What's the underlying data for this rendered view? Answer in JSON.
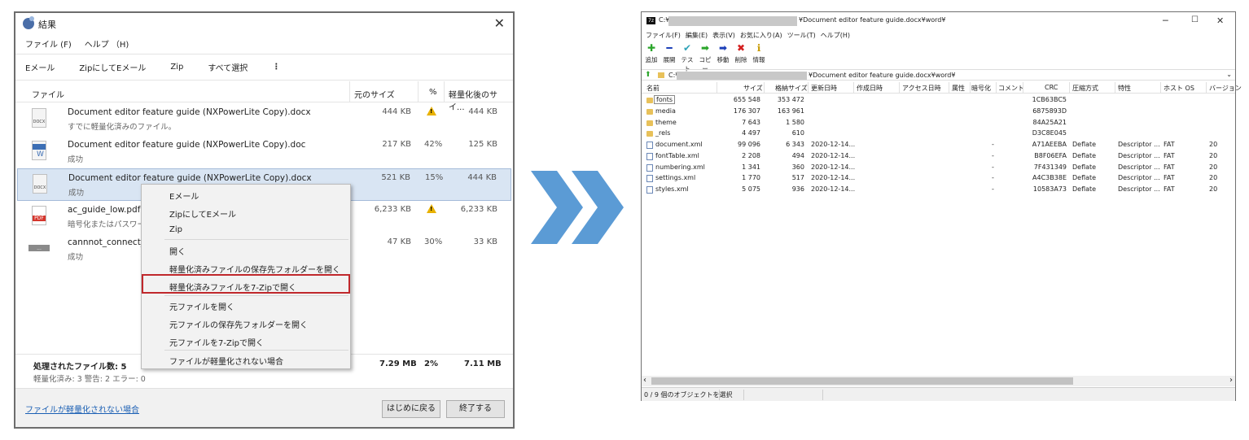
{
  "left_window": {
    "title": "結果",
    "close": "✕",
    "menu": [
      "ファイル (F)",
      "ヘルプ （H)"
    ],
    "toolbar": [
      "Eメール",
      "ZipにしてEメール",
      "Zip",
      "すべて選択",
      "⋮"
    ],
    "columns": {
      "file": "ファイル",
      "orig_size": "元のサイズ",
      "pct": "%",
      "new_size": "軽量化後のサイ..."
    },
    "rows": [
      {
        "name": "Document editor feature guide (NXPowerLite Copy).docx",
        "sub": "すでに軽量化済みのファイル。",
        "orig": "444 KB",
        "pct": "",
        "warn": true,
        "new": "444 KB",
        "icon_tag": "DOCX"
      },
      {
        "name": "Document editor feature guide (NXPowerLite Copy).doc",
        "sub": "成功",
        "orig": "217 KB",
        "pct": "42%",
        "warn": false,
        "new": "125 KB",
        "icon_tag": "DOC"
      },
      {
        "name": "Document editor feature guide (NXPowerLite Copy).docx",
        "sub": "成功",
        "orig": "521 KB",
        "pct": "15%",
        "warn": false,
        "new": "444 KB",
        "icon_tag": "DOCX"
      },
      {
        "name": "ac_guide_low.pdf",
        "sub": "暗号化またはパスワー",
        "orig": "6,233 KB",
        "pct": "",
        "warn": true,
        "new": "6,233 KB",
        "icon_tag": "PDF"
      },
      {
        "name": "cannnot_connect_tc",
        "sub": "成功",
        "orig": "47 KB",
        "pct": "30%",
        "warn": false,
        "new": "33 KB",
        "icon_tag": "..."
      }
    ],
    "totals": {
      "label": "処理されたファイル数: 5",
      "detail": "軽量化済み: 3  警告: 2  エラー: 0",
      "orig": "7.29 MB",
      "pct": "2%",
      "new": "7.11 MB"
    },
    "footer": {
      "link": "ファイルが軽量化されない場合",
      "back_button": "はじめに戻る",
      "finish_button": "終了する"
    }
  },
  "context_menu": {
    "items": [
      "Eメール",
      "ZipにしてEメール",
      "Zip",
      "開く",
      "軽量化済みファイルの保存先フォルダーを開く",
      "軽量化済みファイルを7-Zipで開く",
      "元ファイルを開く",
      "元ファイルの保存先フォルダーを開く",
      "元ファイルを7-Zipで開く",
      "ファイルが軽量化されない場合"
    ],
    "highlighted_index": 5,
    "highlight_color": "#c0282c"
  },
  "arrow_color": "#5b9bd5",
  "right_window": {
    "icon": "7z",
    "title_prefix": "C:¥",
    "title_suffix": "¥Document editor feature guide.docx¥word¥",
    "controls": [
      "─",
      "☐",
      "✕"
    ],
    "menu": [
      "ファイル(F)",
      "編集(E)",
      "表示(V)",
      "お気に入り(A)",
      "ツール(T)",
      "ヘルプ(H)"
    ],
    "toolbar": [
      {
        "label": "追加",
        "glyph": "✚",
        "color": "#2aa52a"
      },
      {
        "label": "展開",
        "glyph": "━",
        "color": "#1c3fb8"
      },
      {
        "label": "テスト",
        "glyph": "✔",
        "color": "#2fa3b8"
      },
      {
        "label": "コピー",
        "glyph": "➡",
        "color": "#2aa52a"
      },
      {
        "label": "移動",
        "glyph": "➡",
        "color": "#1c3fb8"
      },
      {
        "label": "削除",
        "glyph": "✖",
        "color": "#d42020"
      },
      {
        "label": "情報",
        "glyph": "ℹ",
        "color": "#c79a00"
      }
    ],
    "address_prefix": "C:¥",
    "address_suffix": "¥Document editor feature guide.docx¥word¥",
    "columns": [
      "名前",
      "サイズ",
      "格納サイズ",
      "更新日時",
      "作成日時",
      "アクセス日時",
      "属性",
      "暗号化",
      "コメント",
      "CRC",
      "圧縮方式",
      "特性",
      "ホスト OS",
      "バージョン"
    ],
    "rows": [
      {
        "type": "folder",
        "name": "fonts",
        "size": "655 548",
        "packed": "353 472",
        "modified": "",
        "enc": "",
        "crc": "1CB63BC5",
        "method": "",
        "char": "",
        "host": "",
        "ver": ""
      },
      {
        "type": "folder",
        "name": "media",
        "size": "176 307",
        "packed": "163 961",
        "modified": "",
        "enc": "",
        "crc": "6875893D",
        "method": "",
        "char": "",
        "host": "",
        "ver": ""
      },
      {
        "type": "folder",
        "name": "theme",
        "size": "7 643",
        "packed": "1 580",
        "modified": "",
        "enc": "",
        "crc": "84A25A21",
        "method": "",
        "char": "",
        "host": "",
        "ver": ""
      },
      {
        "type": "folder",
        "name": "_rels",
        "size": "4 497",
        "packed": "610",
        "modified": "",
        "enc": "",
        "crc": "D3C8E045",
        "method": "",
        "char": "",
        "host": "",
        "ver": ""
      },
      {
        "type": "file",
        "name": "document.xml",
        "size": "99 096",
        "packed": "6 343",
        "modified": "2020-12-14...",
        "enc": "-",
        "crc": "A71AEEBA",
        "method": "Deflate",
        "char": "Descriptor ...",
        "host": "FAT",
        "ver": "20"
      },
      {
        "type": "file",
        "name": "fontTable.xml",
        "size": "2 208",
        "packed": "494",
        "modified": "2020-12-14...",
        "enc": "-",
        "crc": "B8F06EFA",
        "method": "Deflate",
        "char": "Descriptor ...",
        "host": "FAT",
        "ver": "20"
      },
      {
        "type": "file",
        "name": "numbering.xml",
        "size": "1 341",
        "packed": "360",
        "modified": "2020-12-14...",
        "enc": "-",
        "crc": "7F431349",
        "method": "Deflate",
        "char": "Descriptor ...",
        "host": "FAT",
        "ver": "20"
      },
      {
        "type": "file",
        "name": "settings.xml",
        "size": "1 770",
        "packed": "517",
        "modified": "2020-12-14...",
        "enc": "-",
        "crc": "A4C3B38E",
        "method": "Deflate",
        "char": "Descriptor ...",
        "host": "FAT",
        "ver": "20"
      },
      {
        "type": "file",
        "name": "styles.xml",
        "size": "5 075",
        "packed": "936",
        "modified": "2020-12-14...",
        "enc": "-",
        "crc": "10583A73",
        "method": "Deflate",
        "char": "Descriptor ...",
        "host": "FAT",
        "ver": "20"
      }
    ],
    "scroll_left": "‹",
    "scroll_right": "›",
    "status": "0 / 9 個のオブジェクトを選択"
  }
}
